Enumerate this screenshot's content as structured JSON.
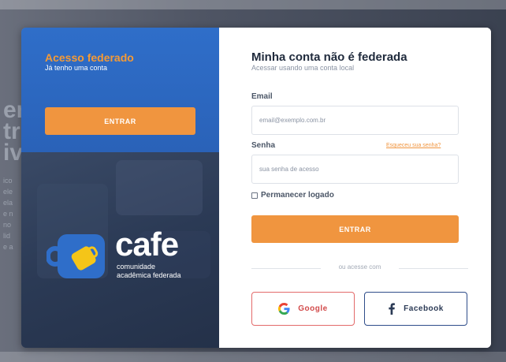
{
  "background": {
    "fragments": [
      "er",
      "tr",
      "iv"
    ],
    "side_lines": [
      "ico",
      "ele",
      "ela",
      "e n",
      "no",
      "lid",
      "e a"
    ]
  },
  "federated": {
    "title": "Acesso federado",
    "subtitle": "Já tenho uma conta",
    "button_label": "ENTRAR",
    "accent_color": "#f0953f",
    "panel_color": "#2f6ec9"
  },
  "logo": {
    "word": "cafe",
    "tagline_1": "comunidade",
    "tagline_2": "acadêmica federada",
    "icon": "coffee-mug-icon"
  },
  "local": {
    "title": "Minha conta não é federada",
    "subtitle": "Acessar usando uma conta local",
    "email_label": "Email",
    "email_placeholder": "email@exemplo.com.br",
    "password_label": "Senha",
    "password_placeholder": "sua senha de acesso",
    "forgot_label": "Esqueceu sua senha?",
    "remember_label": "Permanecer logado",
    "remember_checked": false,
    "submit_label": "ENTRAR",
    "divider_text": "ou acesse com"
  },
  "social": {
    "google_label": "Google",
    "google_icon": "google-g-icon",
    "google_color": "#d24a4a",
    "facebook_label": "Facebook",
    "facebook_icon": "facebook-f-icon",
    "facebook_color": "#2f4d8a"
  }
}
